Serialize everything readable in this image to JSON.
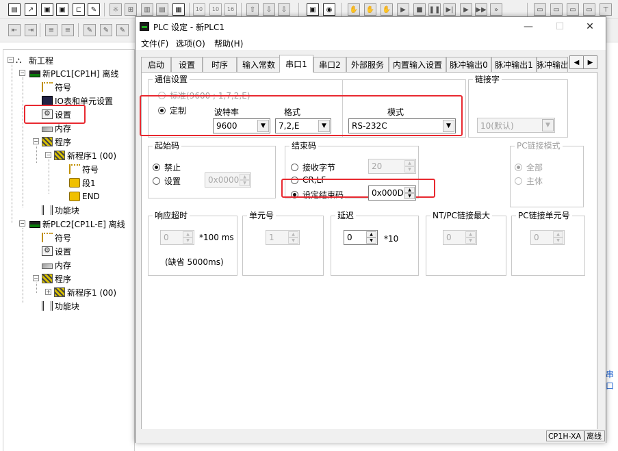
{
  "toolbar": {
    "row1_buttons": [
      "new-project-icon",
      "open-icon",
      "window-icon",
      "window-icon",
      "window-icon",
      "properties-icon",
      "tools-icon",
      "tools-icon",
      "tools-icon",
      "tools-icon"
    ],
    "row1_numbers": [
      "10",
      "10",
      "16"
    ],
    "row2_buttons": [
      "indent-icon",
      "outdent-icon",
      "list-icon",
      "list-icon",
      "pen-icon",
      "pen-icon",
      "pen-icon"
    ],
    "media_icons": [
      "hand-icon",
      "hand-icon",
      "play-icon",
      "stop-icon",
      "pause-icon",
      "step-icon",
      "step-icon",
      "fast-forward-icon"
    ]
  },
  "tree": {
    "root": "新工程",
    "plc1": {
      "label": "新PLC1[CP1H] 离线",
      "symbols": "符号",
      "io_table": "IO表和单元设置",
      "settings": "设置",
      "memory": "内存",
      "programs": "程序",
      "program1": "新程序1 (00)",
      "prog_symbols": "符号",
      "section1": "段1",
      "end": "END",
      "function_blocks": "功能块"
    },
    "plc2": {
      "label": "新PLC2[CP1L-E] 离线",
      "symbols": "符号",
      "settings": "设置",
      "memory": "内存",
      "programs": "程序",
      "program1": "新程序1 (00)",
      "function_blocks": "功能块"
    }
  },
  "background_right_text": "串口",
  "dialog": {
    "title": "PLC 设定 - 新PLC1",
    "minimize": "—",
    "maximize": "☐",
    "close": "✕",
    "menu": [
      "文件(F)",
      "选项(O)",
      "帮助(H)"
    ],
    "tabs": [
      "启动",
      "设置",
      "时序",
      "输入常数",
      "串口1",
      "串口2",
      "外部服务",
      "内置输入设置",
      "脉冲输出0",
      "脉冲输出1",
      "脉冲输出"
    ],
    "active_tab": "串口1",
    "comm": {
      "title": "通信设置",
      "standard": "标准(9600 ; 1,7,2,E)",
      "custom": "定制",
      "baud_label": "波特率",
      "baud_value": "9600",
      "format_label": "格式",
      "format_value": "7,2,E",
      "mode_label": "模式",
      "mode_value": "RS-232C"
    },
    "link_word": {
      "title": "链接字",
      "value": "10(默认)"
    },
    "start_code": {
      "title": "起始码",
      "disable": "禁止",
      "set": "设置",
      "value": "0x0000"
    },
    "end_code": {
      "title": "结束码",
      "receive_bytes": "接收字节",
      "receive_value": "20",
      "crlf": "CR,LF",
      "set_end": "设定结束码",
      "end_value": "0x000D"
    },
    "pc_link_mode": {
      "title": "PC链接模式",
      "all": "全部",
      "master": "主体"
    },
    "response_timeout": {
      "title": "响应超时",
      "value": "0",
      "unit": "*100 ms",
      "default_note": "(缺省 5000ms)"
    },
    "unit_no": {
      "title": "单元号",
      "value": "1"
    },
    "delay": {
      "title": "延迟",
      "value": "0",
      "unit": "*10"
    },
    "nt_pc_max": {
      "title": "NT/PC链接最大",
      "value": "0"
    },
    "pc_link_unit": {
      "title": "PC链接单元号",
      "value": "0"
    },
    "status": {
      "model": "CP1H-XA",
      "state": "离线"
    }
  },
  "colors": {
    "highlight": "#e8282f",
    "panel": "#ffffff",
    "chrome": "#f0f0f0",
    "link_blue": "#1a5fd0"
  }
}
